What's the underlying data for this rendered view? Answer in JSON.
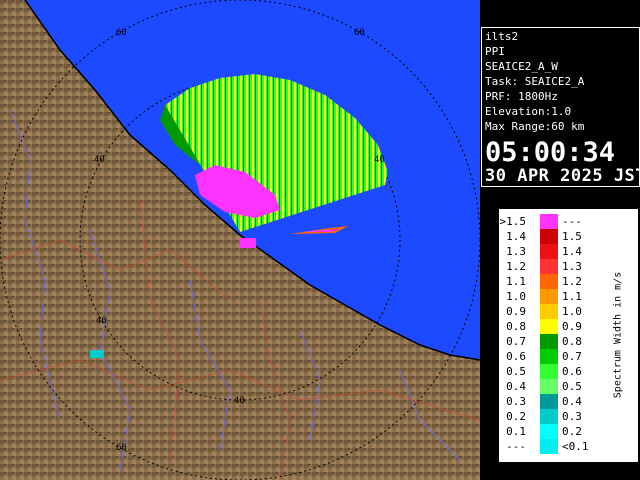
{
  "info": {
    "site": "ilts2",
    "product": "PPI",
    "scan": "SEAICE2_A_W",
    "task": "Task: SEAICE2_A",
    "prf": "PRF: 1800Hz",
    "elevation": "Elevation:1.0",
    "max_range": "Max Range:60 km",
    "time": "05:00:34",
    "date": "30 APR 2025 JST"
  },
  "legend": {
    "title": "Spectrum Width in m/s",
    "rows": [
      {
        "lo": ">1.5",
        "hi": "---",
        "color": "#ff33ff"
      },
      {
        "lo": "1.4",
        "hi": "1.5",
        "color": "#cc0000"
      },
      {
        "lo": "1.3",
        "hi": "1.4",
        "color": "#ee1111"
      },
      {
        "lo": "1.2",
        "hi": "1.3",
        "color": "#ff3333"
      },
      {
        "lo": "1.1",
        "hi": "1.2",
        "color": "#ff6600"
      },
      {
        "lo": "1.0",
        "hi": "1.1",
        "color": "#ff9900"
      },
      {
        "lo": "0.9",
        "hi": "1.0",
        "color": "#ffcc00"
      },
      {
        "lo": "0.8",
        "hi": "0.9",
        "color": "#ffff00"
      },
      {
        "lo": "0.7",
        "hi": "0.8",
        "color": "#009900"
      },
      {
        "lo": "0.6",
        "hi": "0.7",
        "color": "#00cc00"
      },
      {
        "lo": "0.5",
        "hi": "0.6",
        "color": "#33ff33"
      },
      {
        "lo": "0.4",
        "hi": "0.5",
        "color": "#66ff66"
      },
      {
        "lo": "0.3",
        "hi": "0.4",
        "color": "#009999"
      },
      {
        "lo": "0.2",
        "hi": "0.3",
        "color": "#00cccc"
      },
      {
        "lo": "0.1",
        "hi": "0.2",
        "color": "#00ffff"
      },
      {
        "lo": "---",
        "hi": "<0.1",
        "color": "#00eeee"
      }
    ]
  },
  "range_labels": [
    "60",
    "60",
    "40",
    "40",
    "40",
    "40",
    "60"
  ],
  "colors": {
    "sea": "#1e4aff",
    "land": "#8a6d49",
    "rings": "#000000",
    "coast": "#000000"
  }
}
